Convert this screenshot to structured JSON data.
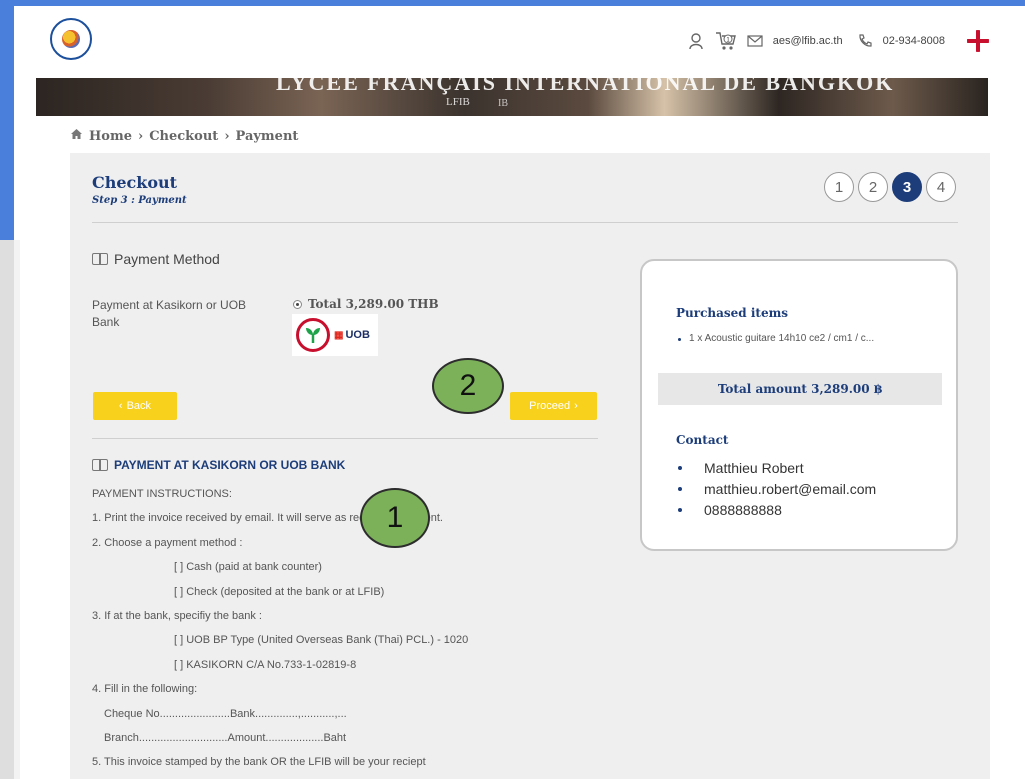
{
  "header": {
    "email": "aes@lfib.ac.th",
    "phone": "02-934-8008",
    "icons": [
      "user-icon",
      "cart-icon",
      "mail-icon",
      "phone-icon",
      "uk-flag-icon"
    ],
    "cart_count": "1"
  },
  "banner": {
    "text": "LYCÉE FRANÇAIS INTERNATIONAL DE BANGKOK",
    "sub": "LFIB",
    "sub2": "IB"
  },
  "breadcrumb": {
    "home": "Home",
    "checkout": "Checkout",
    "payment": "Payment"
  },
  "checkout": {
    "title": "Checkout",
    "step": "Step 3 : Payment",
    "steps": [
      "1",
      "2",
      "3",
      "4"
    ],
    "active_step": 3
  },
  "payment_method": {
    "title": "Payment Method",
    "label": "Payment at Kasikorn or UOB Bank",
    "total": "Total 3,289.00 THB",
    "uob": "UOB"
  },
  "buttons": {
    "back": "Back",
    "proceed": "Proceed"
  },
  "kasikorn_section": {
    "title": "PAYMENT AT KASIKORN OR UOB BANK",
    "lines": [
      "PAYMENT INSTRUCTIONS:",
      "1. Print the invoice received by email. It will serve as receipt of payment.",
      "2. Choose a payment method :",
      "[   ]  Cash (paid at bank counter)",
      "[   ]  Check (deposited at the bank or at LFIB)",
      "3. If at the bank, specifiy the bank :",
      "[   ]  UOB BP Type (United Overseas Bank (Thai) PCL.) - 1020",
      "[   ]  KASIKORN  C/A No.733-1-02819-8",
      "4. Fill in the following:",
      "Cheque No.......................Bank..............,...........,...",
      "Branch.............................Amount...................Baht",
      "5. This invoice stamped by the bank OR the LFIB will be your reciept"
    ]
  },
  "summary": {
    "purchased_title": "Purchased items",
    "item": "1 x Acoustic guitare 14h10 ce2 / cm1 / c...",
    "total": "Total amount 3,289.00 ฿",
    "contact_title": "Contact",
    "contacts": [
      "Matthieu Robert",
      "matthieu.robert@email.com",
      "0888888888"
    ]
  },
  "markers": {
    "one": "1",
    "two": "2"
  },
  "colors": {
    "frame": "#4a7fdc",
    "navy": "#1c3d7a",
    "button": "#f7d11c",
    "marker": "#7cb15a"
  }
}
